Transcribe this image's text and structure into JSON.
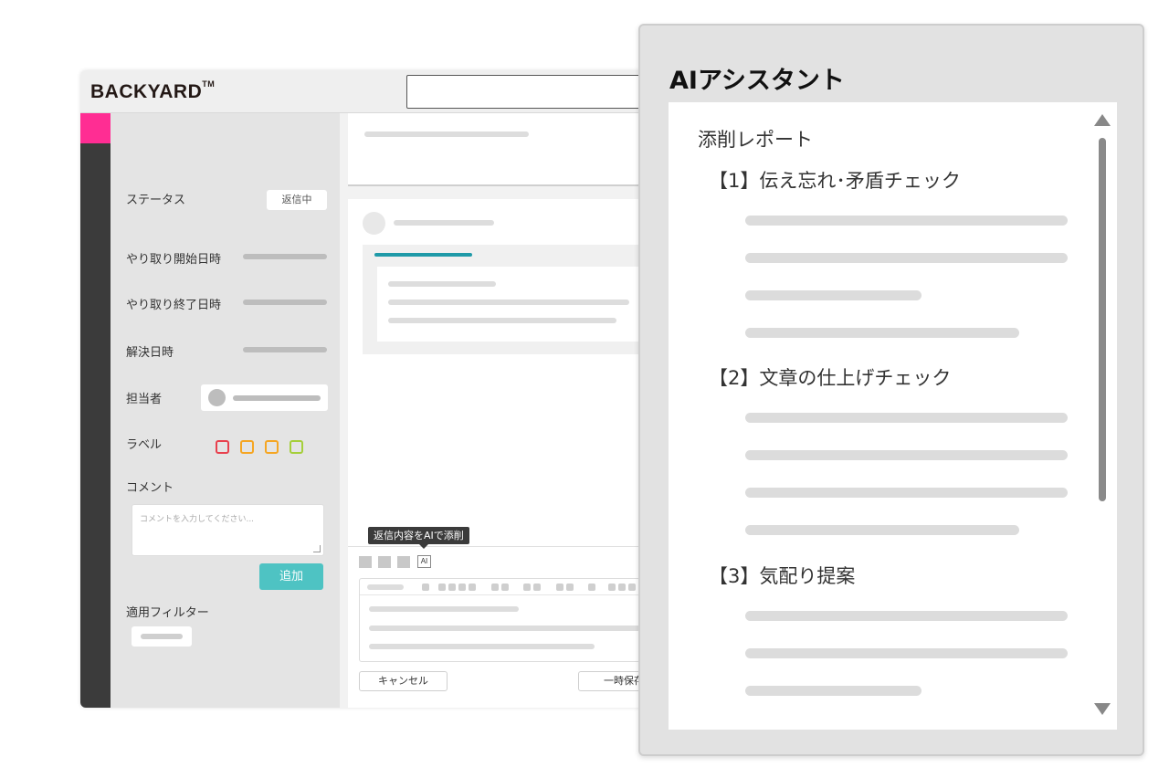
{
  "app": {
    "logo": "BACKYARD",
    "logo_tm": "TM"
  },
  "sidebar": {
    "status_label": "ステータス",
    "status_value": "返信中",
    "start_label": "やり取り開始日時",
    "end_label": "やり取り終了日時",
    "resolved_label": "解決日時",
    "assignee_label": "担当者",
    "label_label": "ラベル",
    "label_colors": [
      "#e8414e",
      "#f5a623",
      "#f5a623",
      "#a5cf3a"
    ],
    "comment_label": "コメント",
    "comment_placeholder": "コメントを入力してください...",
    "add_button": "追加",
    "filter_label": "適用フィルター"
  },
  "editor": {
    "ai_tooltip": "返信内容をAIで添削",
    "ai_button": "AI",
    "cancel_button": "キャンセル",
    "save_button": "一時保存"
  },
  "assistant": {
    "title": "AIアシスタント",
    "report_title": "添削レポート",
    "sections": [
      {
        "heading": "【1】伝え忘れ･矛盾チェック"
      },
      {
        "heading": "【2】文章の仕上げチェック"
      },
      {
        "heading": "【3】気配り提案"
      }
    ]
  },
  "colors": {
    "accent_pink": "#ff2d93",
    "accent_teal": "#4ec3c3",
    "quote_line": "#1f9aa8"
  }
}
